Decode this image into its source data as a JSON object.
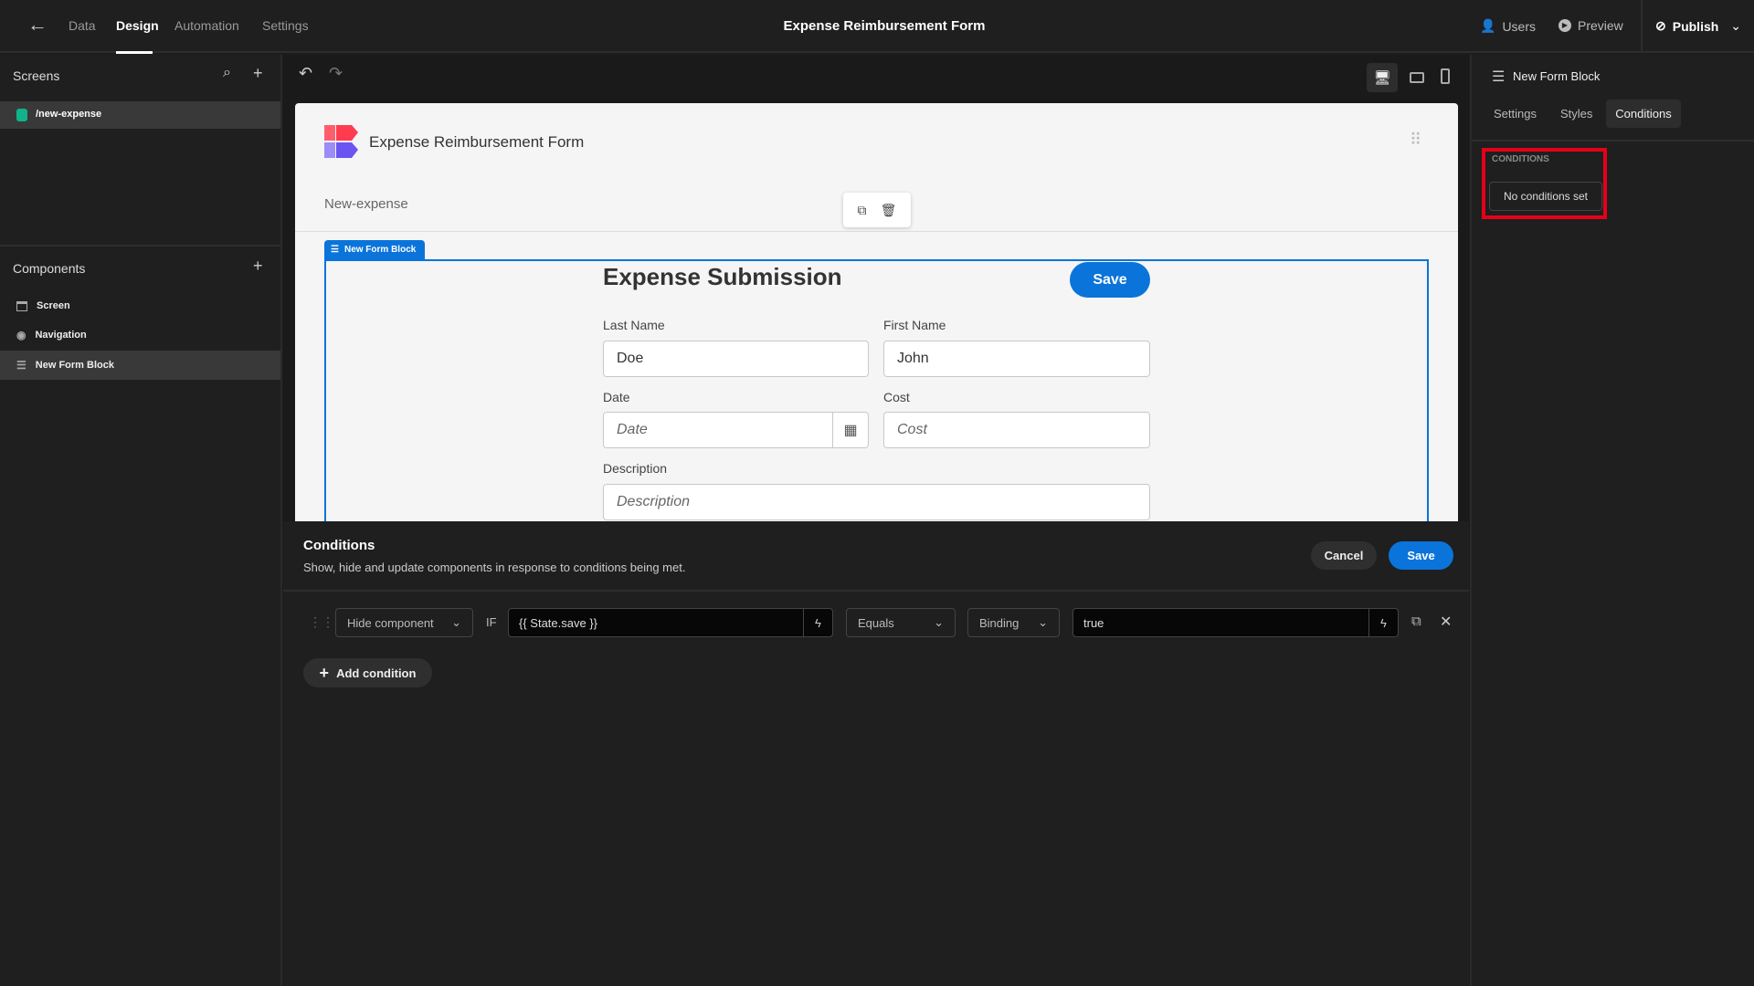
{
  "topbar": {
    "back_icon": "arrow-left-icon",
    "tabs": [
      {
        "label": "Data"
      },
      {
        "label": "Design",
        "active": true
      },
      {
        "label": "Automation"
      },
      {
        "label": "Settings"
      }
    ],
    "title": "Expense Reimbursement Form",
    "users": "Users",
    "preview": "Preview",
    "publish": "Publish"
  },
  "sidebar": {
    "screens_title": "Screens",
    "screens": [
      {
        "label": "/new-expense",
        "color": "#10b38a"
      }
    ],
    "components_title": "Components",
    "components": [
      {
        "label": "Screen",
        "icon": "screen-icon"
      },
      {
        "label": "Navigation",
        "icon": "eye-icon"
      },
      {
        "label": "New Form Block",
        "icon": "form-icon",
        "selected": true
      }
    ]
  },
  "preview": {
    "app_title": "Expense Reimbursement Form",
    "screen_name": "New-expense",
    "block_label": "New Form Block",
    "form_title": "Expense Submission",
    "save": "Save",
    "fields": {
      "last_name": {
        "label": "Last Name",
        "value": "Doe"
      },
      "first_name": {
        "label": "First Name",
        "value": "John"
      },
      "date": {
        "label": "Date",
        "placeholder": "Date"
      },
      "cost": {
        "label": "Cost",
        "placeholder": "Cost"
      },
      "description": {
        "label": "Description",
        "placeholder": "Description"
      }
    }
  },
  "conditions": {
    "title": "Conditions",
    "subtitle": "Show, hide and update components in response to conditions being met.",
    "cancel": "Cancel",
    "save": "Save",
    "rows": [
      {
        "action": "Hide component",
        "if": "IF",
        "binding": "{{ State.save }}",
        "operator": "Equals",
        "value_type": "Binding",
        "value": "true"
      }
    ],
    "add": "Add condition"
  },
  "rpanel": {
    "title": "New Form Block",
    "tabs": [
      "Settings",
      "Styles",
      "Conditions"
    ],
    "active_tab": "Conditions",
    "section": "CONDITIONS",
    "empty": "No conditions set",
    "highlight": "#e5001a"
  },
  "colors": {
    "accent": "#0a74da"
  }
}
